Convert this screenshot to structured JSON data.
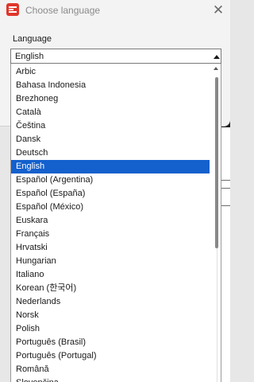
{
  "dialog": {
    "title": "Choose language",
    "close_glyph": "✕",
    "field_label": "Language",
    "selected_value": "English"
  },
  "languages": [
    "Arbic",
    "Bahasa Indonesia",
    "Brezhoneg",
    "Català",
    "Čeština",
    "Dansk",
    "Deutsch",
    "English",
    "Español (Argentina)",
    "Español (España)",
    "Español (México)",
    "Euskara",
    "Français",
    "Hrvatski",
    "Hungarian",
    "Italiano",
    "Korean (한국어)",
    "Nederlands",
    "Norsk",
    "Polish",
    "Português (Brasil)",
    "Português (Portugal)",
    "Română",
    "Slovenčina"
  ],
  "selected_index": 7,
  "colors": {
    "accent": "#1460cd",
    "app_icon": "#e0362b"
  },
  "icons": {
    "app": "app-logo-icon",
    "close": "close-icon",
    "dropdown": "chevron-up-icon"
  }
}
